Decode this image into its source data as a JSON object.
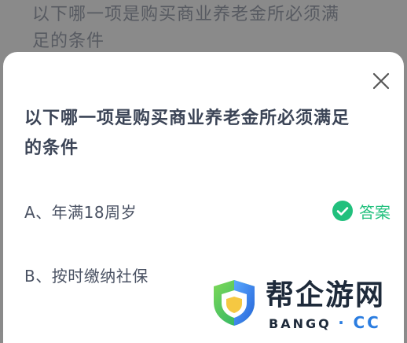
{
  "background": {
    "question_line1": "以下哪一项是购买商业养老金所必须满",
    "question_line2": "足的条件"
  },
  "sheet": {
    "question_line1": "以下哪一项是购买商业养老金所必须满足",
    "question_line2": "的条件",
    "options": [
      {
        "label": "A、年满18周岁",
        "answer": "答案"
      },
      {
        "label": "B、按时缴纳社保"
      }
    ],
    "close_icon": "close-icon",
    "answer_icon": "check-circle-icon"
  },
  "watermark": {
    "title": "帮企游网",
    "sub_left": "BANGQ",
    "sub_dot": "·",
    "sub_right": "CC",
    "logo_icon": "shield-logo-icon"
  },
  "colors": {
    "accent": "#21c07d",
    "text": "#3b4456",
    "watermark_blue": "#2b7de0"
  }
}
